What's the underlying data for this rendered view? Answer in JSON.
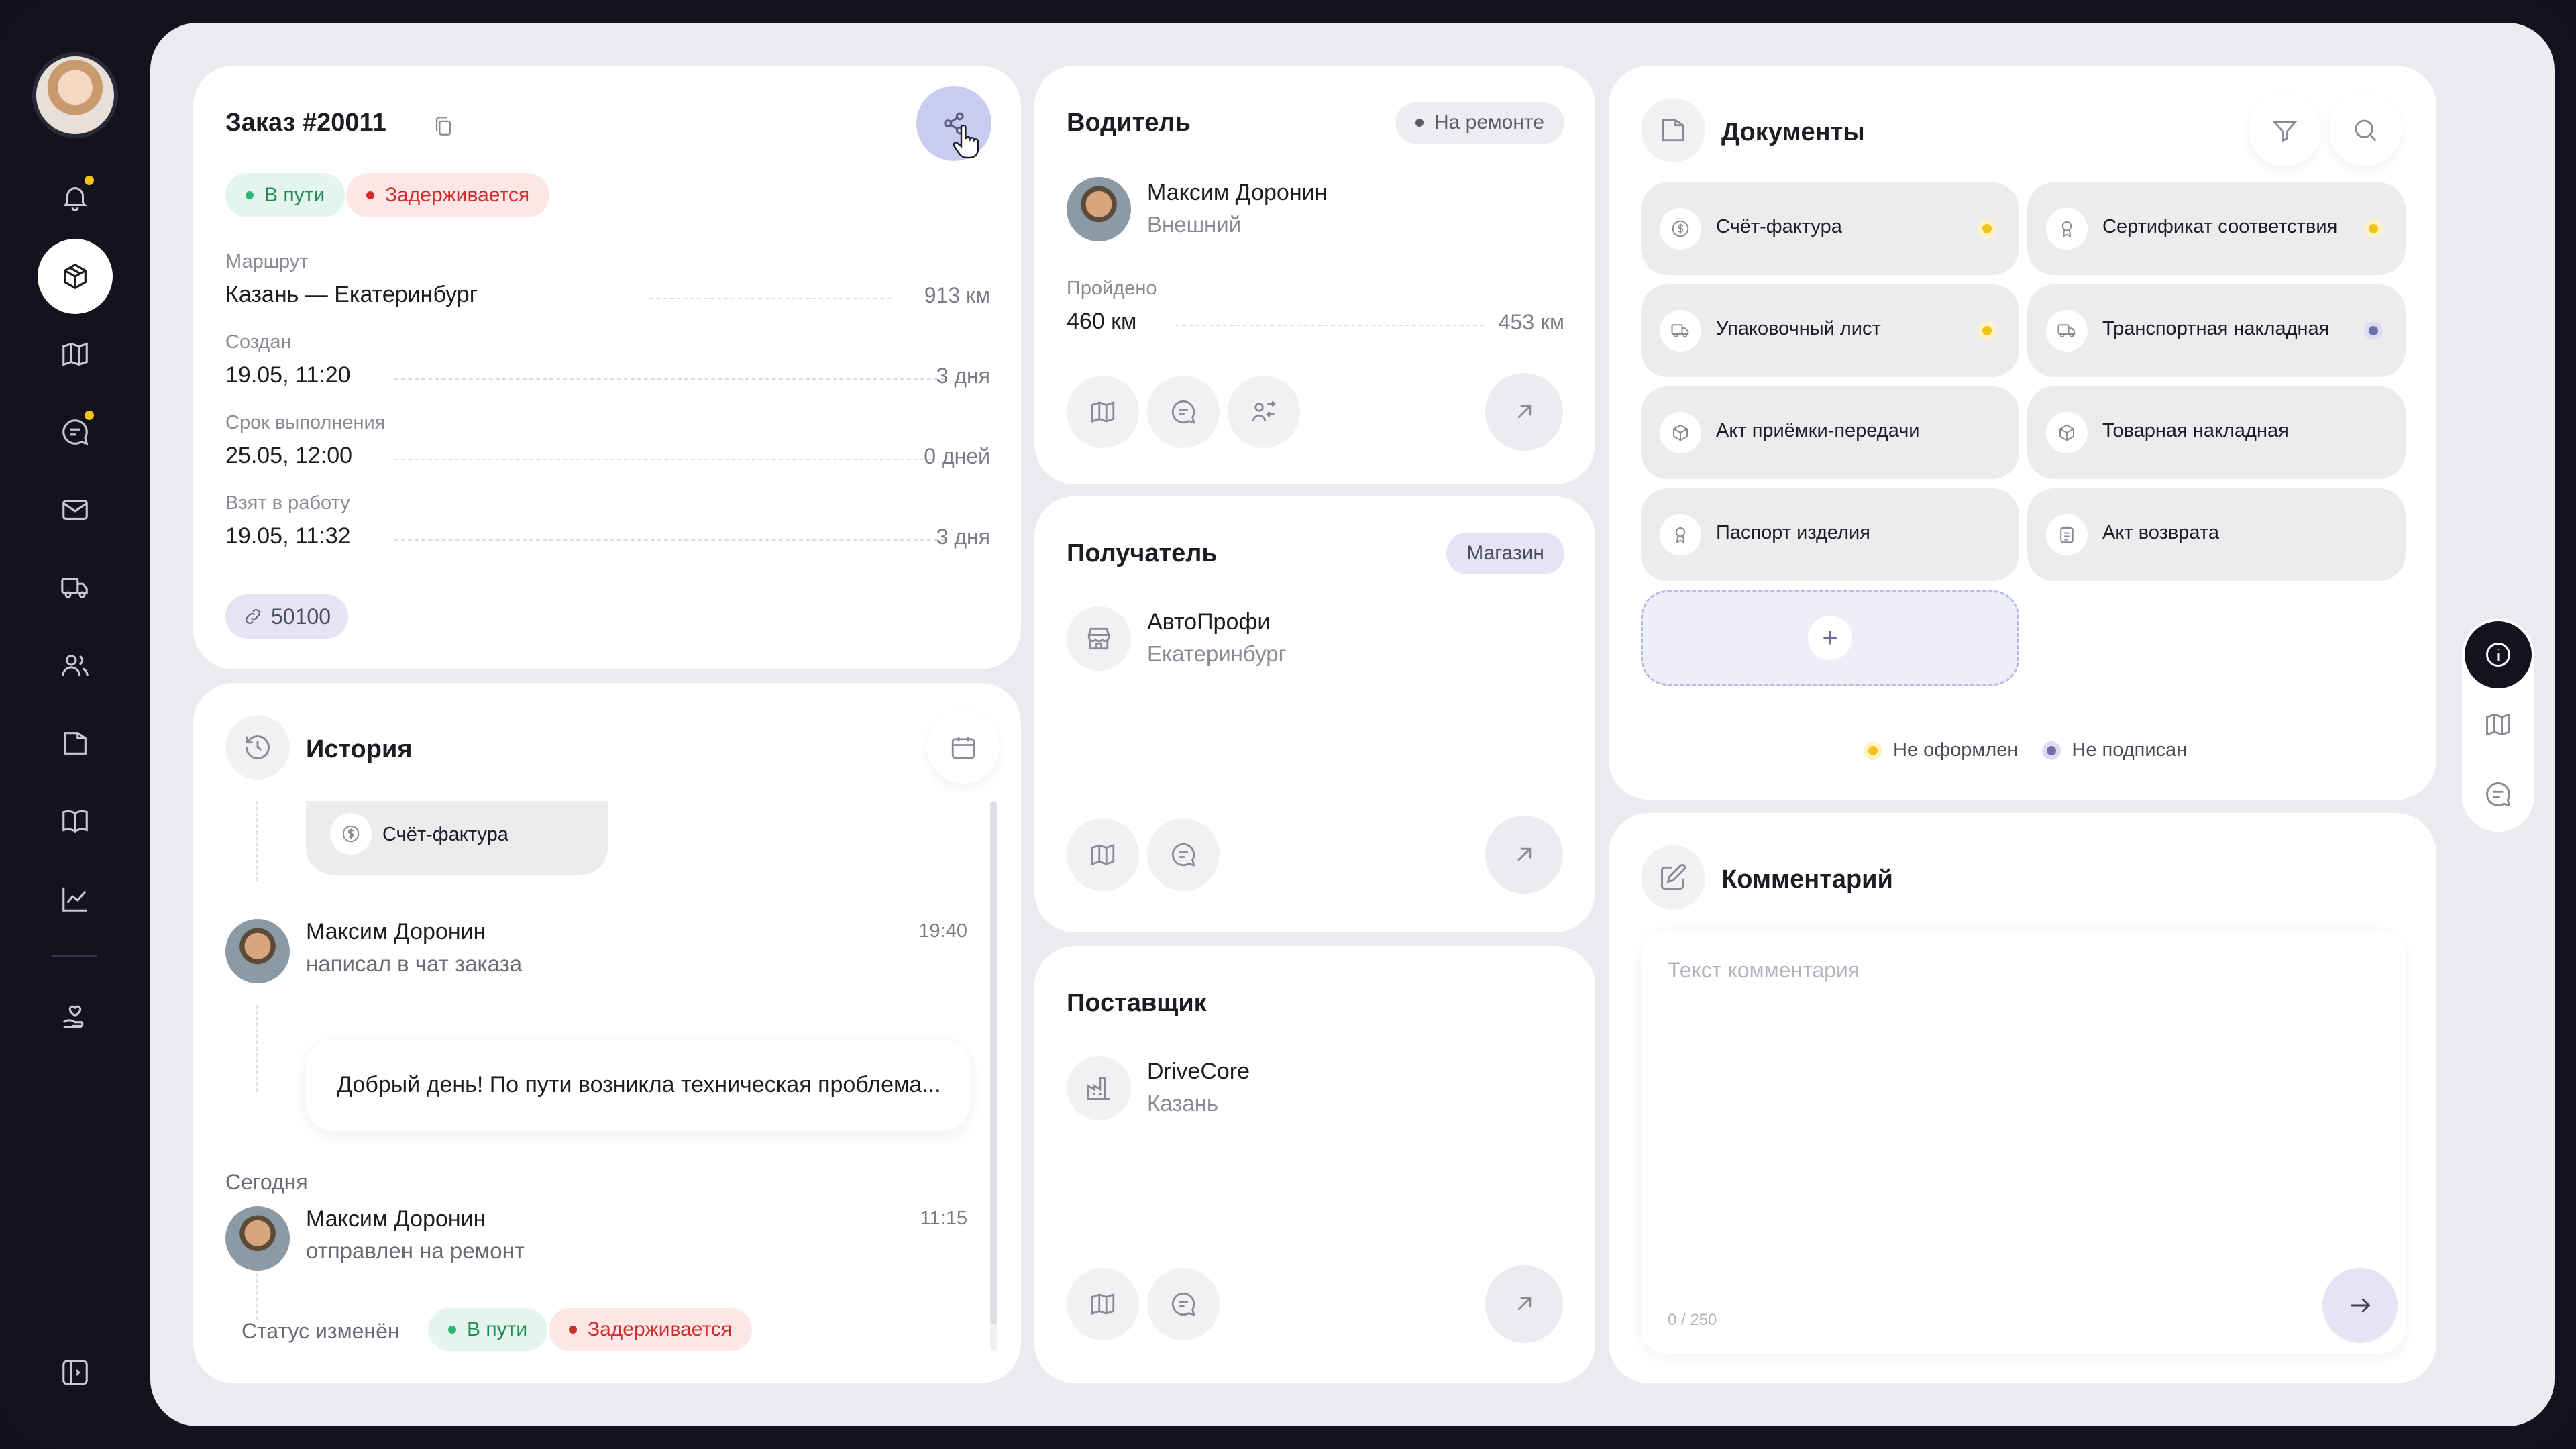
{
  "order": {
    "title": "Заказ #20011",
    "status_on_way": "В пути",
    "status_delayed": "Задерживается",
    "route_label": "Маршрут",
    "route_value": "Казань — Екатеринбург",
    "route_right": "913 км",
    "created_label": "Создан",
    "created_value": "19.05, 11:20",
    "created_right": "3 дня",
    "deadline_label": "Срок выполнения",
    "deadline_value": "25.05, 12:00",
    "deadline_right": "0 дней",
    "taken_label": "Взят в работу",
    "taken_value": "19.05, 11:32",
    "taken_right": "3 дня",
    "link_code": "50100"
  },
  "history": {
    "title": "История",
    "doc_chip": "Счёт-фактура",
    "entry1_name": "Максим Доронин",
    "entry1_action": "написал в чат заказа",
    "entry1_time": "19:40",
    "entry1_message": "Добрый день! По пути возникла техническая проблема...",
    "today_label": "Сегодня",
    "entry2_name": "Максим Доронин",
    "entry2_action": "отправлен на ремонт",
    "entry2_time": "11:15",
    "status_changed": "Статус изменён",
    "status_on_way": "В пути",
    "status_delayed": "Задерживается"
  },
  "driver": {
    "title": "Водитель",
    "badge": "На ремонте",
    "name": "Максим Доронин",
    "type": "Внешний",
    "passed_label": "Пройдено",
    "passed_value": "460 км",
    "passed_right": "453 км"
  },
  "recipient": {
    "title": "Получатель",
    "badge": "Магазин",
    "name": "АвтоПрофи",
    "city": "Екатеринбург"
  },
  "supplier": {
    "title": "Поставщик",
    "name": "DriveCore",
    "city": "Казань"
  },
  "documents": {
    "title": "Документы",
    "items": [
      {
        "label": "Счёт-фактура",
        "icon": "dollar-circle-icon",
        "status": "not-issued"
      },
      {
        "label": "Сертификат соответствия",
        "icon": "award-icon",
        "status": "not-issued"
      },
      {
        "label": "Упаковочный лист",
        "icon": "truck-icon",
        "status": "not-issued"
      },
      {
        "label": "Транспортная накладная",
        "icon": "truck-icon",
        "status": "not-signed"
      },
      {
        "label": "Акт приёмки-передачи",
        "icon": "box-icon",
        "status": ""
      },
      {
        "label": "Товарная накладная",
        "icon": "box-icon",
        "status": ""
      },
      {
        "label": "Паспорт изделия",
        "icon": "award-icon",
        "status": ""
      },
      {
        "label": "Акт возврата",
        "icon": "clipboard-icon",
        "status": ""
      }
    ],
    "legend_not_issued": "Не оформлен",
    "legend_not_signed": "Не подписан"
  },
  "comment": {
    "title": "Комментарий",
    "placeholder": "Текст комментария",
    "counter": "0 / 250"
  },
  "colors": {
    "accent_lavender": "#c9cbf1",
    "green": "#2bb673",
    "red": "#d22b2b",
    "yellow": "#f2c21b",
    "not_signed": "#7070a8"
  }
}
